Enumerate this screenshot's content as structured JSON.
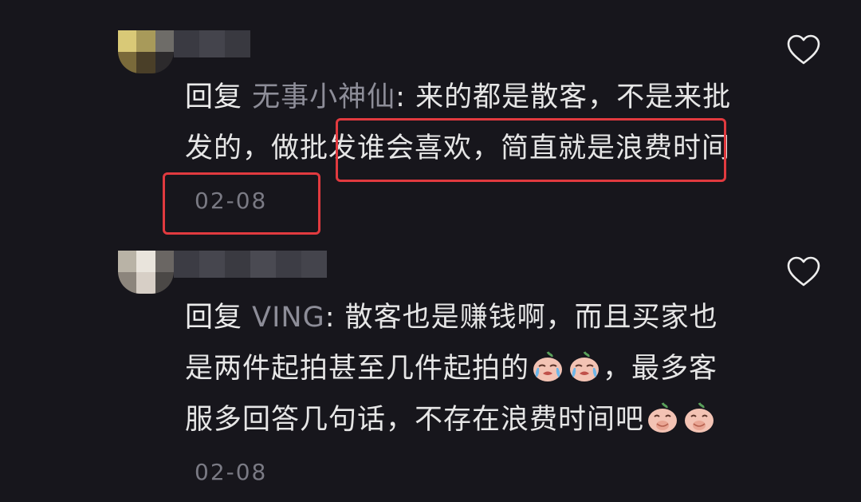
{
  "colors": {
    "background": "#17161c",
    "text": "#e6e6e6",
    "mention": "#8d8d98",
    "timestamp": "#7a7a84",
    "highlight_box": "#e13a3f"
  },
  "comments": [
    {
      "reply_word": "回复",
      "mention": "无事小神仙",
      "separator": ": ",
      "text_a": "来的都是散客，不是来批发的，",
      "text_highlight": "做批发谁会喜欢，简直就是浪费时间",
      "date": "02-08",
      "username": "",
      "avatar_icon": "blurred-avatar",
      "like_icon": "heart-outline-icon",
      "highlighted": true
    },
    {
      "reply_word": "回复",
      "mention": "VING",
      "separator": ": ",
      "text_a": "散客也是赚钱啊，而且买家也是两件起拍甚至几件起拍的",
      "emoji_a": [
        "crying-face-emoji",
        "crying-face-emoji"
      ],
      "text_b": "，最多客服多回答几句话，不存在浪费时间吧",
      "emoji_b": [
        "laughing-cover-mouth-emoji",
        "laughing-cover-mouth-emoji"
      ],
      "date": "02-08",
      "username": "",
      "avatar_icon": "blurred-avatar",
      "like_icon": "heart-outline-icon",
      "highlighted": false
    }
  ]
}
